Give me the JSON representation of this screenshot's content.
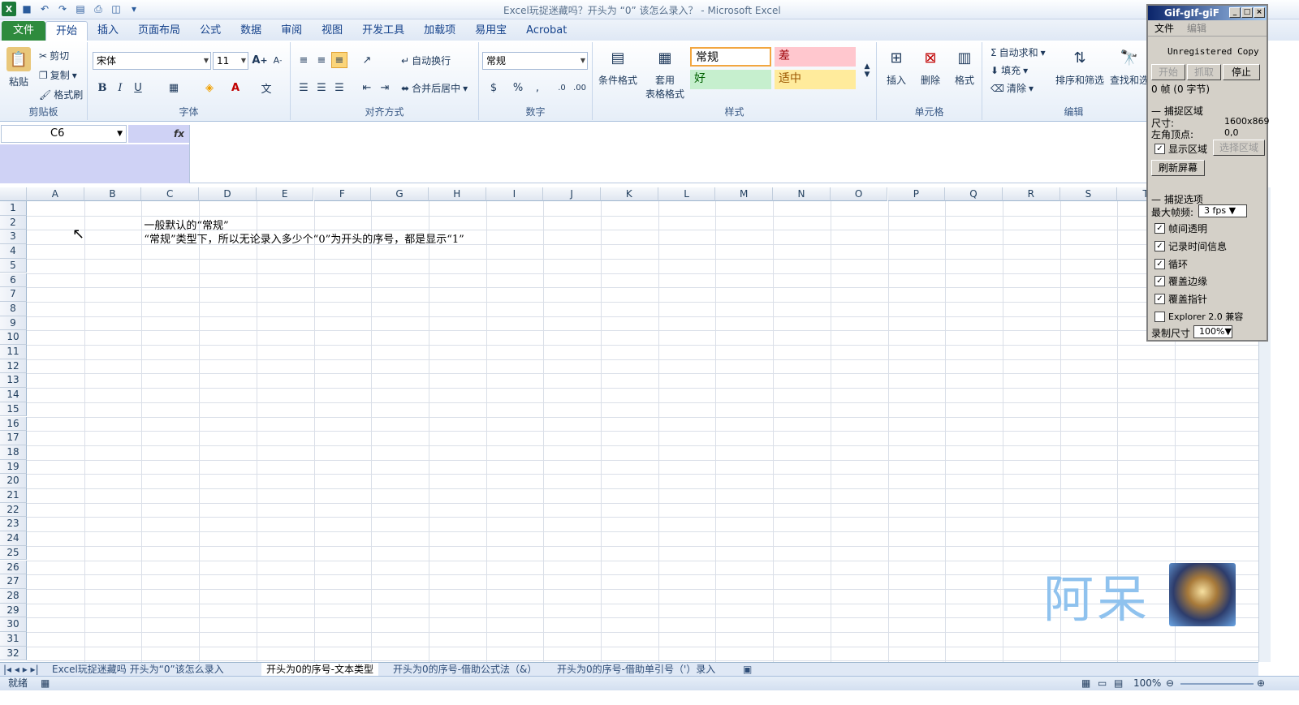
{
  "window": {
    "title": "Excel玩捉迷藏吗？开头为 “0” 该怎么录入？ - Microsoft Excel"
  },
  "ribbon_tabs": [
    "文件",
    "开始",
    "插入",
    "页面布局",
    "公式",
    "数据",
    "审阅",
    "视图",
    "开发工具",
    "加载项",
    "易用宝",
    "Acrobat"
  ],
  "clipboard": {
    "paste": "粘贴",
    "cut": "剪切",
    "copy": "复制",
    "format_painter": "格式刷",
    "label": "剪贴板"
  },
  "font": {
    "name": "宋体",
    "size": "11",
    "label": "字体"
  },
  "alignment": {
    "wrap": "自动换行",
    "merge": "合并后居中",
    "label": "对齐方式"
  },
  "number": {
    "format": "常规",
    "label": "数字"
  },
  "styles": {
    "conditional": "条件格式",
    "table_format_1": "套用",
    "table_format_2": "表格格式",
    "normal": "常规",
    "bad": "差",
    "good": "好",
    "neutral": "适中",
    "label": "样式"
  },
  "cells": {
    "insert": "插入",
    "delete": "删除",
    "format": "格式",
    "label": "单元格"
  },
  "editing": {
    "autosum": "自动求和",
    "fill": "填充",
    "clear": "清除",
    "sort": "排序和筛选",
    "find": "查找和选",
    "label": "编辑"
  },
  "formula_bar": {
    "name_box": "C6",
    "fx": "fx",
    "formula": ""
  },
  "columns": [
    "A",
    "B",
    "C",
    "D",
    "E",
    "F",
    "G",
    "H",
    "I",
    "J",
    "K",
    "L",
    "M",
    "N",
    "O",
    "P",
    "Q",
    "R",
    "S",
    "T"
  ],
  "rows": [
    "1",
    "2",
    "3",
    "4",
    "5",
    "6",
    "7",
    "8",
    "9",
    "10",
    "11",
    "12",
    "13",
    "14",
    "15",
    "16",
    "17",
    "18",
    "19",
    "20",
    "21",
    "22",
    "23",
    "24",
    "25",
    "26",
    "27",
    "28",
    "29",
    "30",
    "31",
    "32"
  ],
  "cell_content": {
    "c2": "一般默认的“常规”",
    "c3": "“常规”类型下，所以无论录入多少个“0”为开头的序号，都是显示“1”"
  },
  "sheets": [
    "Excel玩捉迷藏吗 开头为“0”该怎么录入",
    "开头为0的序号-文本类型",
    "开头为0的序号-借助公式法（&）",
    "开头为0的序号-借助单引号（'）录入"
  ],
  "status": {
    "ready": "就绪",
    "zoom": "100%"
  },
  "gif_tool": {
    "title": "Gif-gIf-giF",
    "menu_file": "文件",
    "menu_edit": "编辑",
    "unregistered": "Unregistered Copy",
    "start": "开始",
    "capture": "抓取",
    "stop": "停止",
    "frames": "0 帧 (0 字节)",
    "capture_area": "捕捉区域",
    "size_label": "尺寸:",
    "size_value": "1600x869",
    "origin_label": "左角顶点:",
    "origin_value": "0,0",
    "show_area": "显示区域",
    "select_area": "选择区域",
    "refresh": "刷新屏幕",
    "capture_options": "捕捉选项",
    "max_fps_label": "最大帧频:",
    "max_fps": "3 fps",
    "opt_transparent": "帧间透明",
    "opt_time": "记录时间信息",
    "opt_loop": "循环",
    "opt_edge": "覆盖边缘",
    "opt_cursor": "覆盖指针",
    "opt_explorer": "Explorer 2.0 兼容",
    "record_size_label": "录制尺寸",
    "record_size": "100%"
  },
  "watermark": "阿呆"
}
